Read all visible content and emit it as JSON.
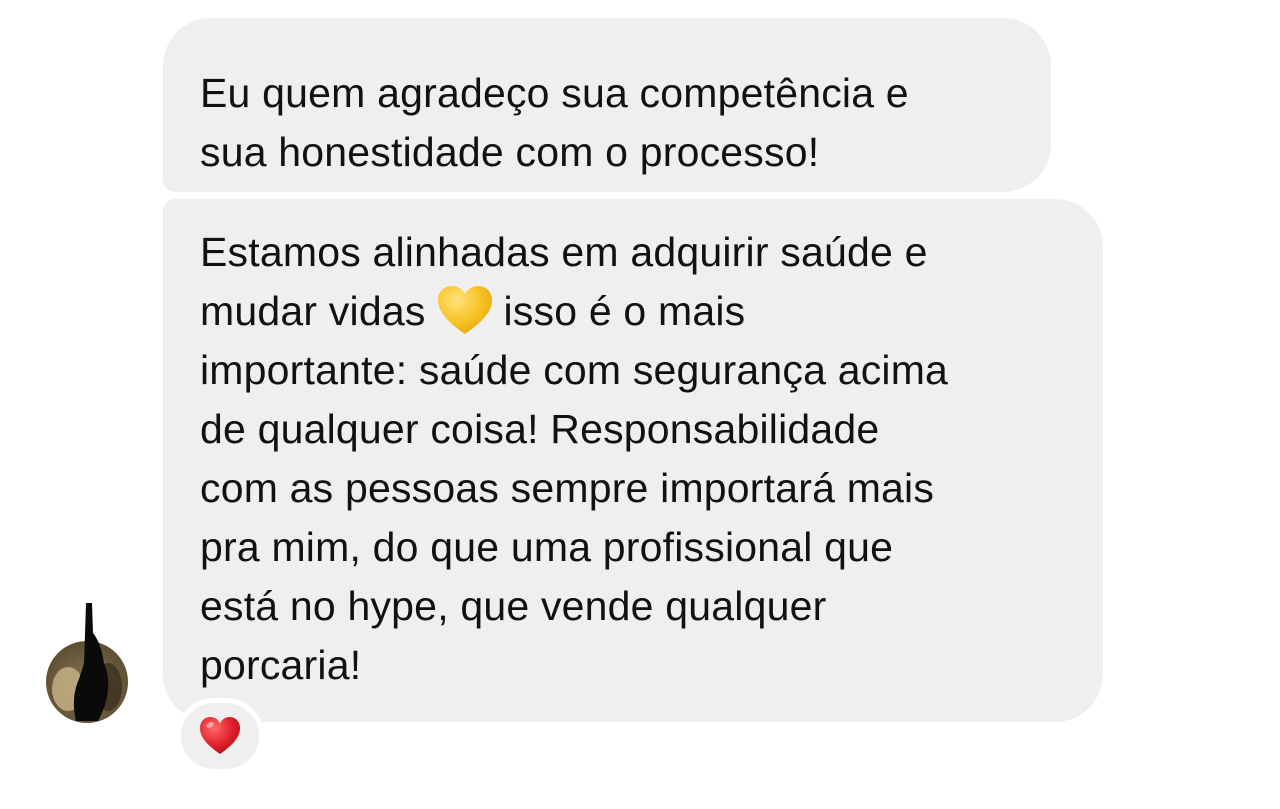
{
  "messages": [
    {
      "lines": [
        "Eu quem agradeço sua competência e",
        "sua honestidade com o processo!"
      ]
    },
    {
      "line1": "Estamos alinhadas em adquirir saúde e",
      "line2_before_emoji": "mudar vidas",
      "line2_emoji": "yellow-heart-emoji",
      "line2_after_emoji": "isso é o mais",
      "lines_rest": [
        "importante: saúde com segurança acima",
        "de qualquer coisa! Responsabilidade",
        "com as pessoas sempre importará mais",
        "pra mim, do que uma profissional que",
        "está no hype, que vende qualquer",
        "porcaria!"
      ],
      "reaction": "red-heart-emoji"
    }
  ],
  "sender": {
    "avatar": "avatar-obscured-photo"
  },
  "colors": {
    "bubble_bg": "#efefef",
    "text": "#111111",
    "yellow_heart": "#f7c325",
    "red_heart": "#e0212b"
  }
}
